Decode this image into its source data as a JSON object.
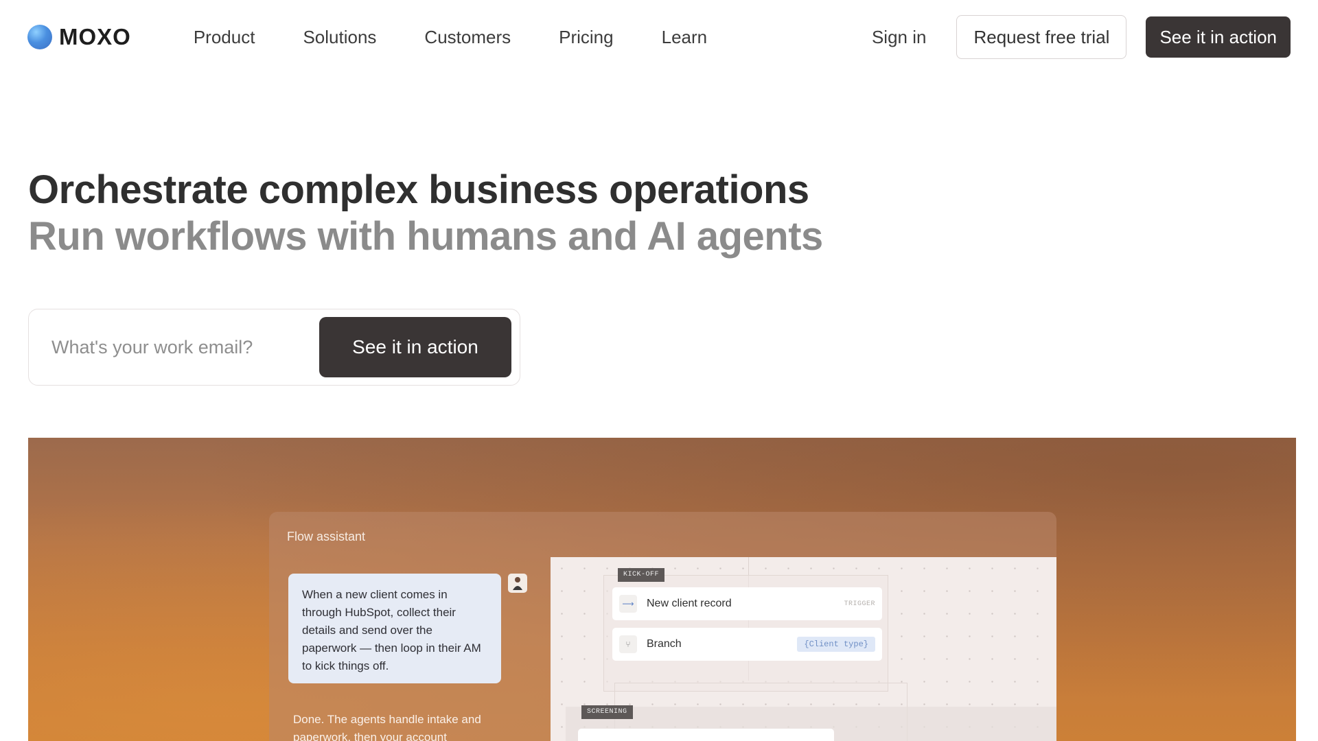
{
  "brand": {
    "name": "MOXO",
    "accent": "#4a8fe0"
  },
  "nav": {
    "items": [
      {
        "label": "Product"
      },
      {
        "label": "Solutions"
      },
      {
        "label": "Customers"
      },
      {
        "label": "Pricing"
      },
      {
        "label": "Learn"
      }
    ],
    "signin": "Sign in",
    "trial": "Request free trial",
    "cta": "See it in action"
  },
  "hero": {
    "title": "Orchestrate complex business operations",
    "subtitle": "Run workflows with humans and AI agents",
    "email_placeholder": "What's your work email?",
    "cta": "See it in action"
  },
  "showcase": {
    "panel_title": "Flow assistant",
    "user_message": "When a new client comes in through HubSpot, collect their details and send over the paperwork — then loop in their AM to kick things off.",
    "assistant_reply": "Done. The agents handle intake and paperwork, then your account",
    "flow": {
      "kickoff_tag": "KICK-OFF",
      "node1_label": "New client record",
      "node1_tag": "TRIGGER",
      "node2_label": "Branch",
      "node2_chip": "{Client type}",
      "screening_tag": "SCREENING"
    }
  },
  "colors": {
    "dark_button": "#3a3535",
    "showcase_bg": "#c47b3d"
  }
}
